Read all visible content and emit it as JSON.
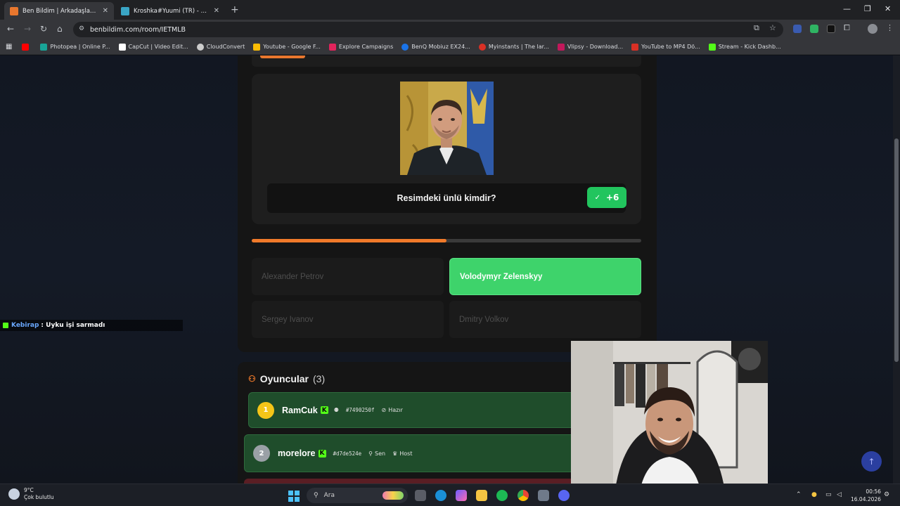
{
  "browser": {
    "tabs": [
      {
        "title": "Ben Bildim | Arkadaşlarınla",
        "active": true,
        "favicon_color": "#e8772e"
      },
      {
        "title": "Kroshka#Yuumi (TR) - LeagueO",
        "active": false,
        "favicon_color": "#3aa5c5"
      }
    ],
    "url": "benbildim.com/room/IETMLB",
    "bookmarks": [
      {
        "label": "",
        "color": "#ff0000"
      },
      {
        "label": "Photopea | Online P...",
        "color": "#18a497"
      },
      {
        "label": "CapCut | Video Edit...",
        "color": "#ffffff"
      },
      {
        "label": "CloudConvert",
        "color": "#cccccc"
      },
      {
        "label": "Youtube - Google F...",
        "color": "#fbbc04"
      },
      {
        "label": "Explore Campaigns",
        "color": "#e2245c"
      },
      {
        "label": "BenQ Mobiuz EX24...",
        "color": "#1a73e8"
      },
      {
        "label": "Myinstants | The lar...",
        "color": "#d93025"
      },
      {
        "label": "Vlipsy - Download...",
        "color": "#c2185b"
      },
      {
        "label": "YouTube to MP4 Dö...",
        "color": "#d93025"
      },
      {
        "label": "Stream - Kick Dashb...",
        "color": "#53fc18"
      }
    ]
  },
  "question": {
    "text": "Resimdeki ünlü kimdir?",
    "points": "+6",
    "progress": 0.5
  },
  "answers": [
    {
      "label": "Alexander Petrov",
      "correct": false
    },
    {
      "label": "Volodymyr Zelenskyy",
      "correct": true
    },
    {
      "label": "Sergey Ivanov",
      "correct": false
    },
    {
      "label": "Dmitry Volkov",
      "correct": false
    }
  ],
  "players": {
    "title": "Oyuncular",
    "count": "(3)",
    "list": [
      {
        "rank": "1",
        "name": "RamCuk",
        "tag": "#7490250f",
        "status": "Hazır",
        "rank_color": "#f5c518"
      },
      {
        "rank": "2",
        "name": "morelore",
        "tag": "#d7de524e",
        "you": "Sen",
        "host": "Host",
        "rank_color": "#9aa0a6"
      }
    ]
  },
  "chat": {
    "user": "Kebirap",
    "message": ": Uyku işi sarmadı"
  },
  "taskbar": {
    "temp": "9°C",
    "weather": "Çok bulutlu",
    "search": "Ara",
    "time": "00:56",
    "date": "16.04.2026"
  }
}
